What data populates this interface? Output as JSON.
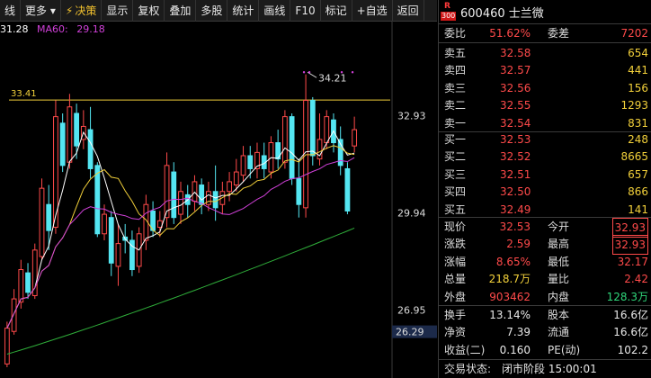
{
  "toolbar": {
    "items": [
      {
        "label": "线",
        "icon": "chart-line-icon"
      },
      {
        "label": "更多",
        "icon": "chevron-down-icon"
      },
      {
        "label": "决策",
        "icon": "lightning-icon"
      },
      {
        "label": "显示"
      },
      {
        "label": "复权"
      },
      {
        "label": "叠加"
      },
      {
        "label": "多股"
      },
      {
        "label": "统计"
      },
      {
        "label": "画线"
      },
      {
        "label": "F10"
      },
      {
        "label": "标记"
      },
      {
        "label": "+自选"
      },
      {
        "label": "返回"
      }
    ]
  },
  "legend": {
    "ma_left": "31.28",
    "ma60_label": "MA60:",
    "ma60_value": "29.18"
  },
  "chart": {
    "price_axis": [
      "32.93",
      "29.94",
      "26.95"
    ],
    "low_marker": "26.29",
    "resistance_value": "33.41",
    "high_marker": "34.21"
  },
  "colors": {
    "up": "#ff4a4a",
    "down": "#2fd67a",
    "ma5": "#ffffff",
    "ma10": "#f2d03a",
    "ma20": "#d040d8",
    "ma60": "#2fae3a",
    "candle_down": "#54e6f2"
  },
  "chart_data": {
    "type": "candlestick",
    "ylim": [
      25.2,
      35.6
    ],
    "candles": [
      {
        "o": 25.3,
        "c": 26.4,
        "h": 26.6,
        "l": 25.2
      },
      {
        "o": 26.3,
        "c": 27.3,
        "h": 27.6,
        "l": 26.2
      },
      {
        "o": 27.2,
        "c": 28.2,
        "h": 28.5,
        "l": 27.0
      },
      {
        "o": 28.1,
        "c": 27.5,
        "h": 28.4,
        "l": 27.3
      },
      {
        "o": 27.4,
        "c": 28.8,
        "h": 29.0,
        "l": 27.3
      },
      {
        "o": 28.6,
        "c": 30.7,
        "h": 31.0,
        "l": 28.5
      },
      {
        "o": 30.2,
        "c": 29.4,
        "h": 30.8,
        "l": 28.8
      },
      {
        "o": 29.5,
        "c": 32.9,
        "h": 33.4,
        "l": 29.3
      },
      {
        "o": 32.7,
        "c": 31.4,
        "h": 33.0,
        "l": 31.2
      },
      {
        "o": 31.5,
        "c": 33.2,
        "h": 33.6,
        "l": 31.3
      },
      {
        "o": 33.0,
        "c": 32.0,
        "h": 33.3,
        "l": 31.6
      },
      {
        "o": 32.2,
        "c": 32.6,
        "h": 33.1,
        "l": 31.9
      },
      {
        "o": 32.5,
        "c": 31.3,
        "h": 33.2,
        "l": 31.0
      },
      {
        "o": 31.4,
        "c": 29.3,
        "h": 31.5,
        "l": 29.2
      },
      {
        "o": 29.3,
        "c": 29.9,
        "h": 30.2,
        "l": 29.1
      },
      {
        "o": 29.8,
        "c": 28.4,
        "h": 30.0,
        "l": 28.0
      },
      {
        "o": 28.3,
        "c": 29.0,
        "h": 29.6,
        "l": 27.7
      },
      {
        "o": 29.2,
        "c": 29.1,
        "h": 29.6,
        "l": 28.7
      },
      {
        "o": 29.1,
        "c": 28.2,
        "h": 29.4,
        "l": 28.0
      },
      {
        "o": 28.3,
        "c": 29.3,
        "h": 29.5,
        "l": 28.1
      },
      {
        "o": 29.1,
        "c": 30.2,
        "h": 30.5,
        "l": 28.8
      },
      {
        "o": 30.0,
        "c": 29.4,
        "h": 30.3,
        "l": 29.2
      },
      {
        "o": 29.5,
        "c": 29.7,
        "h": 30.0,
        "l": 29.2
      },
      {
        "o": 29.8,
        "c": 31.4,
        "h": 31.8,
        "l": 29.5
      },
      {
        "o": 31.2,
        "c": 29.8,
        "h": 31.5,
        "l": 29.6
      },
      {
        "o": 29.9,
        "c": 30.6,
        "h": 30.9,
        "l": 29.6
      },
      {
        "o": 30.5,
        "c": 30.2,
        "h": 30.8,
        "l": 29.8
      },
      {
        "o": 30.3,
        "c": 30.9,
        "h": 31.1,
        "l": 30.0
      },
      {
        "o": 30.8,
        "c": 30.2,
        "h": 31.0,
        "l": 29.9
      },
      {
        "o": 30.2,
        "c": 30.6,
        "h": 30.9,
        "l": 30.0
      },
      {
        "o": 30.6,
        "c": 30.1,
        "h": 31.4,
        "l": 29.7
      },
      {
        "o": 30.2,
        "c": 30.6,
        "h": 30.9,
        "l": 29.9
      },
      {
        "o": 30.6,
        "c": 30.9,
        "h": 31.2,
        "l": 30.3
      },
      {
        "o": 30.8,
        "c": 31.2,
        "h": 31.6,
        "l": 30.6
      },
      {
        "o": 31.1,
        "c": 31.7,
        "h": 32.0,
        "l": 30.9
      },
      {
        "o": 31.7,
        "c": 31.3,
        "h": 32.0,
        "l": 31.0
      },
      {
        "o": 31.3,
        "c": 31.8,
        "h": 32.1,
        "l": 31.0
      },
      {
        "o": 31.7,
        "c": 31.3,
        "h": 32.1,
        "l": 31.0
      },
      {
        "o": 31.2,
        "c": 32.1,
        "h": 32.3,
        "l": 31.0
      },
      {
        "o": 32.1,
        "c": 31.6,
        "h": 32.5,
        "l": 31.3
      },
      {
        "o": 31.5,
        "c": 32.9,
        "h": 33.1,
        "l": 31.3
      },
      {
        "o": 32.9,
        "c": 31.0,
        "h": 33.0,
        "l": 30.8
      },
      {
        "o": 31.0,
        "c": 30.2,
        "h": 31.6,
        "l": 29.8
      },
      {
        "o": 30.1,
        "c": 33.4,
        "h": 34.2,
        "l": 29.8
      },
      {
        "o": 33.4,
        "c": 31.7,
        "h": 33.5,
        "l": 31.4
      },
      {
        "o": 31.6,
        "c": 32.2,
        "h": 33.0,
        "l": 31.4
      },
      {
        "o": 32.1,
        "c": 32.9,
        "h": 33.1,
        "l": 31.9
      },
      {
        "o": 32.8,
        "c": 32.1,
        "h": 33.0,
        "l": 31.8
      },
      {
        "o": 32.2,
        "c": 31.4,
        "h": 32.6,
        "l": 31.1
      },
      {
        "o": 31.3,
        "c": 30.0,
        "h": 31.5,
        "l": 29.9
      },
      {
        "o": 32.0,
        "c": 32.5,
        "h": 32.9,
        "l": 31.8
      }
    ]
  },
  "stock": {
    "badge_r": "R",
    "badge_num": "300",
    "title": "600460 士兰微"
  },
  "order_ratio": {
    "label1": "委比",
    "value1": "51.62%",
    "label2": "委差",
    "value2": "7202"
  },
  "asks": [
    {
      "label": "卖五",
      "price": "32.58",
      "vol": "654"
    },
    {
      "label": "卖四",
      "price": "32.57",
      "vol": "441"
    },
    {
      "label": "卖三",
      "price": "32.56",
      "vol": "156"
    },
    {
      "label": "卖二",
      "price": "32.55",
      "vol": "1293"
    },
    {
      "label": "卖一",
      "price": "32.54",
      "vol": "831"
    }
  ],
  "bids": [
    {
      "label": "买一",
      "price": "32.53",
      "vol": "248"
    },
    {
      "label": "买二",
      "price": "32.52",
      "vol": "8665"
    },
    {
      "label": "买三",
      "price": "32.51",
      "vol": "657"
    },
    {
      "label": "买四",
      "price": "32.50",
      "vol": "866"
    },
    {
      "label": "买五",
      "price": "32.49",
      "vol": "141"
    }
  ],
  "quote": [
    {
      "l1": "现价",
      "v1": "32.53",
      "c1": "up",
      "l2": "今开",
      "v2": "32.93",
      "c2": "up",
      "box2": true
    },
    {
      "l1": "涨跌",
      "v1": "2.59",
      "c1": "up",
      "l2": "最高",
      "v2": "32.93",
      "c2": "up",
      "box2": true
    },
    {
      "l1": "涨幅",
      "v1": "8.65%",
      "c1": "up",
      "l2": "最低",
      "v2": "32.17",
      "c2": "up",
      "box2": false
    },
    {
      "l1": "总量",
      "v1": "218.7万",
      "c1": "yel",
      "l2": "量比",
      "v2": "2.42",
      "c2": "up",
      "box2": false
    },
    {
      "l1": "外盘",
      "v1": "903462",
      "c1": "up",
      "l2": "内盘",
      "v2": "128.3万",
      "c2": "dn",
      "box2": false
    }
  ],
  "stats": [
    {
      "l1": "换手",
      "v1": "13.14%",
      "l2": "股本",
      "v2": "16.6亿"
    },
    {
      "l1": "净资",
      "v1": "7.39",
      "l2": "流通",
      "v2": "16.6亿"
    },
    {
      "l1": "收益(二)",
      "v1": "0.160",
      "l2": "PE(动)",
      "v2": "102.2"
    }
  ],
  "status": {
    "label": "交易状态:",
    "value": "闭市阶段 15:00:01"
  }
}
